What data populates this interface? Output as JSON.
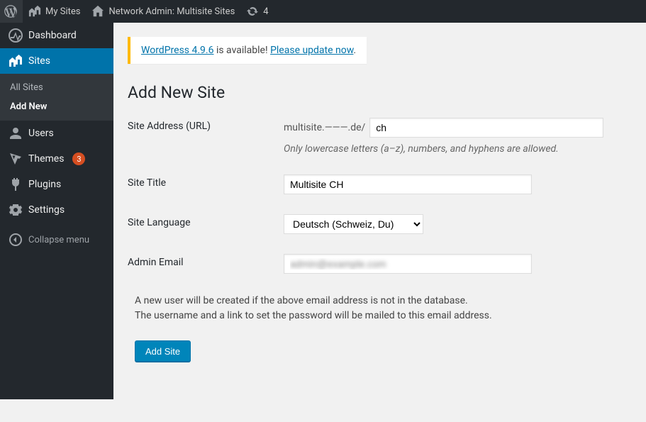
{
  "adminbar": {
    "mysites": "My Sites",
    "site_title": "Network Admin: Multisite Sites",
    "updates_count": "4"
  },
  "sidebar": {
    "dashboard": "Dashboard",
    "sites": "Sites",
    "sites_sub": {
      "all": "All Sites",
      "add": "Add New"
    },
    "users": "Users",
    "themes": "Themes",
    "themes_badge": "3",
    "plugins": "Plugins",
    "settings": "Settings",
    "collapse": "Collapse menu"
  },
  "nag": {
    "link1": "WordPress 4.9.6",
    "mid": " is available! ",
    "link2": "Please update now"
  },
  "page": {
    "title": "Add New Site"
  },
  "form": {
    "site_address": {
      "label": "Site Address (URL)",
      "prefix": "multisite.———.de/",
      "value": "ch",
      "hint": "Only lowercase letters (a–z), numbers, and hyphens are allowed."
    },
    "site_title": {
      "label": "Site Title",
      "value": "Multisite CH"
    },
    "site_lang": {
      "label": "Site Language",
      "selected": "Deutsch (Schweiz, Du)"
    },
    "admin_email": {
      "label": "Admin Email",
      "value": "admin@example.com"
    },
    "note_line1": "A new user will be created if the above email address is not in the database.",
    "note_line2": "The username and a link to set the password will be mailed to this email address.",
    "submit": "Add Site"
  }
}
